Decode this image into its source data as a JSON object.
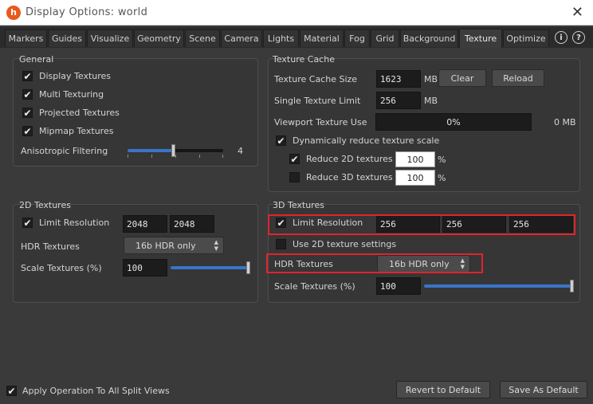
{
  "window": {
    "app_icon": "houdini-icon",
    "title": "Display Options:  world",
    "close_label": "✕"
  },
  "tabs": [
    {
      "label": "Markers"
    },
    {
      "label": "Guides"
    },
    {
      "label": "Visualize"
    },
    {
      "label": "Geometry"
    },
    {
      "label": "Scene"
    },
    {
      "label": "Camera"
    },
    {
      "label": "Lights"
    },
    {
      "label": "Material"
    },
    {
      "label": "Fog"
    },
    {
      "label": "Grid"
    },
    {
      "label": "Background"
    },
    {
      "label": "Texture",
      "active": true
    },
    {
      "label": "Optimize"
    }
  ],
  "tab_icons": {
    "info": "i",
    "help": "?"
  },
  "general": {
    "title": "General",
    "display_textures": {
      "label": "Display Textures",
      "checked": true
    },
    "multi_texturing": {
      "label": "Multi Texturing",
      "checked": true
    },
    "projected_textures": {
      "label": "Projected Textures",
      "checked": true
    },
    "mipmap_textures": {
      "label": "Mipmap Textures",
      "checked": true
    },
    "anisotropic": {
      "label": "Anisotropic Filtering",
      "value": "4",
      "level": 0.5
    }
  },
  "cache": {
    "title": "Texture Cache",
    "cache_size_label": "Texture Cache Size",
    "cache_size_value": "1623",
    "cache_size_unit": "MB",
    "clear_label": "Clear",
    "reload_label": "Reload",
    "single_limit_label": "Single Texture Limit",
    "single_limit_value": "256",
    "single_limit_unit": "MB",
    "viewport_use_label": "Viewport Texture Use",
    "viewport_use_percent": "0%",
    "viewport_use_mb": "0 MB",
    "dynamic_label": "Dynamically reduce texture scale",
    "reduce_2d_label": "Reduce 2D textures",
    "reduce_2d_value": "100",
    "reduce_3d_label": "Reduce 3D textures",
    "reduce_3d_value": "100",
    "percent_unit": "%"
  },
  "tex2d": {
    "title": "2D Textures",
    "limit_label": "Limit Resolution",
    "limit_w": "2048",
    "limit_h": "2048",
    "hdr_label": "HDR Textures",
    "hdr_value": "16b HDR only",
    "scale_label": "Scale Textures (%)",
    "scale_value": "100",
    "scale_level": 1.0
  },
  "tex3d": {
    "title": "3D Textures",
    "limit_label": "Limit Resolution",
    "limit_x": "256",
    "limit_y": "256",
    "limit_z": "256",
    "use2d_label": "Use 2D texture settings",
    "hdr_label": "HDR Textures",
    "hdr_value": "16b HDR only",
    "scale_label": "Scale Textures (%)",
    "scale_value": "100",
    "scale_level": 1.0
  },
  "footer": {
    "apply_label": "Apply Operation To All Split Views",
    "revert_label": "Revert to Default",
    "save_label": "Save As Default"
  },
  "checkmark": "✔",
  "highlight_color": "#e0242d"
}
